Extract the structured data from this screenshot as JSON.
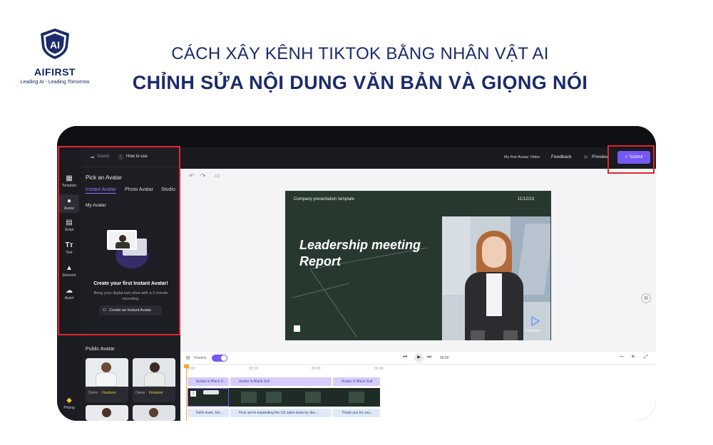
{
  "brand": {
    "logo_text": "AI",
    "name": "AIFIRST",
    "tagline": "Leading AI - Leading Tomorrow"
  },
  "heading": {
    "line1": "CÁCH XÂY KÊNH TIKTOK BẰNG NHÂN VẬT AI",
    "line2": "CHỈNH SỬA NỘI DUNG VĂN BẢN VÀ GIỌNG NÓI"
  },
  "app": {
    "top": {
      "saved_label": "Saved",
      "how_to_use_label": "How to use",
      "video_title": "My first Avatar Video",
      "feedback_label": "Feedback",
      "preview_label": "Preview",
      "submit_label": "Submit"
    },
    "sidebar": {
      "items": [
        {
          "label": "Template",
          "icon": "template-icon"
        },
        {
          "label": "Avatar",
          "icon": "avatar-icon"
        },
        {
          "label": "Script",
          "icon": "script-icon"
        },
        {
          "label": "Text",
          "icon": "text-icon"
        },
        {
          "label": "Element",
          "icon": "element-icon"
        },
        {
          "label": "Asset",
          "icon": "asset-icon"
        }
      ],
      "pricing_label": "Pricing"
    },
    "panel": {
      "title": "Pick an Avatar",
      "tabs": [
        "Instant Avatar",
        "Photo Avatar",
        "Studio"
      ],
      "section": "My Avatar",
      "cta_title": "Create your first Instant Avatar!",
      "cta_desc_1": "Bring your digital twin alive with a 2-minute",
      "cta_desc_2": "recording.",
      "cta_button": "Create an Instant Avatar",
      "public_title": "Public Avatar",
      "cards": [
        {
          "tag": "Demo",
          "badge": "Finetune"
        },
        {
          "tag": "Demo",
          "badge": "Finetune"
        }
      ]
    },
    "slide": {
      "template_label": "Company presentation template",
      "date": "11/12/23",
      "title_1": "Leadership meeting",
      "title_2": "Report",
      "watermark": "HeyGen"
    },
    "timeline": {
      "toggle_label": "Timeline",
      "time_readout": "00:00",
      "ruler": [
        "00:00",
        "00:10",
        "00:20",
        "00:30"
      ],
      "tracks": [
        {
          "label": "Avatar in Black S..."
        },
        {
          "label": "Avatar in Black Suit"
        },
        {
          "label": "Avatar in Black Suit"
        }
      ],
      "scripts": [
        {
          "label": "Hello team, hor..."
        },
        {
          "label": "First, we're expanding the US sales team by doc..."
        },
        {
          "label": "Thank you for you..."
        }
      ]
    }
  }
}
